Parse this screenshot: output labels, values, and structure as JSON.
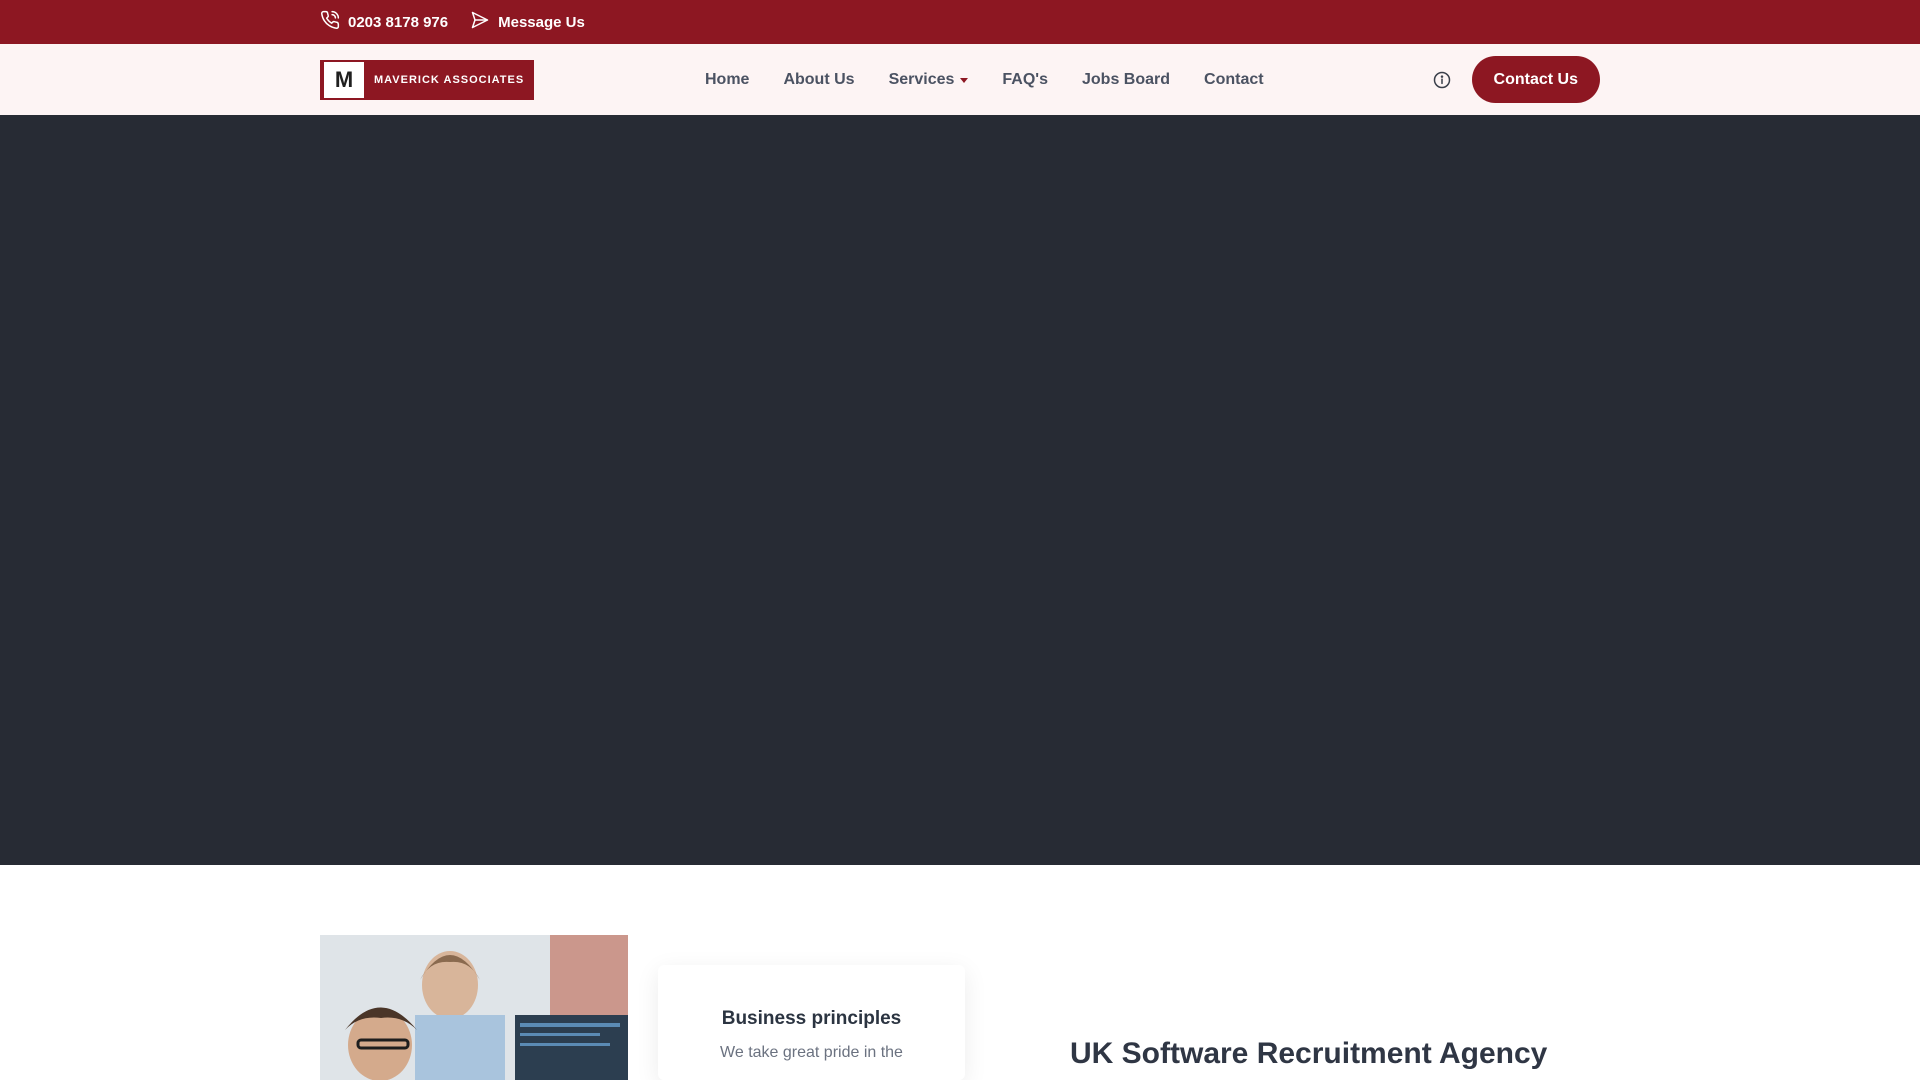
{
  "topbar": {
    "phone": "0203 8178 976",
    "message": "Message Us",
    "icons": [
      "phone-icon",
      "send-icon"
    ]
  },
  "header": {
    "logo": {
      "mark": "M",
      "wordmark": "MAVERICK ASSOCIATES"
    },
    "nav": [
      {
        "label": "Home"
      },
      {
        "label": "About Us"
      },
      {
        "label": "Services",
        "has_dropdown": true
      },
      {
        "label": "FAQ's"
      },
      {
        "label": "Jobs Board"
      },
      {
        "label": "Contact"
      }
    ],
    "info_icon": "info-icon",
    "cta_label": "Contact Us"
  },
  "content": {
    "card": {
      "title": "Business principles",
      "text": "We take great pride in the"
    },
    "section_title": "UK Software Recruitment Agency"
  },
  "colors": {
    "brand": "#8d1722",
    "header_bg": "#fdf4f4",
    "hero_bg": "#272b34",
    "nav_text": "#4b5262"
  }
}
